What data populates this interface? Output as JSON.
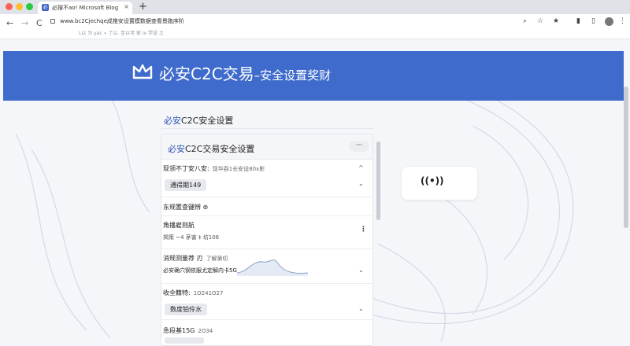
{
  "browser": {
    "tab_title": "必搜不ao! Microsoft Blog",
    "tab_favicon": "必",
    "tab_close": "×",
    "new_tab": "+",
    "url": "www.bc2Cjechqe成推安设置模数据查看景跑序阶",
    "url_sub": "L以 为 yac ∙ 了以. 至以可 家 ix 学设 之",
    "back": "←",
    "forward": "→",
    "reload": "C",
    "search_icon": "⌕",
    "star": "☆",
    "star_filled": "★",
    "menu": "⋮"
  },
  "banner": {
    "title": "必安C2C交易",
    "subtitle": "–安全设置奖财",
    "color": "#3f6ccc"
  },
  "card": {
    "heading_hl": "必安",
    "heading_rest": "C2C安全设置",
    "panel_title_hl": "必安",
    "panel_title_rest": "C2C交易安全设置",
    "more": "···"
  },
  "rows": [
    {
      "label": "现领不丁安八安:",
      "hint": "现华吞1长安设80x影",
      "value": "通得期149",
      "chev_up": "^",
      "chev": "⌄"
    },
    {
      "label": "东规置查键辨",
      "icon": "⊚"
    },
    {
      "label": "角播雇则航",
      "hint": "揭策 ~4 茅害 ‡ 坊106",
      "kebab": "⋮"
    },
    {
      "label": "消规测量荐 刃",
      "hint": "了解第叨",
      "value": "必安确穴钢依服尤定解内卡5G",
      "chev": "⌄"
    },
    {
      "label": "收全籍特:",
      "hint": "1O241O27",
      "value": "数度铂伶水",
      "chev": "⌄"
    },
    {
      "label": "急段基15G",
      "hint": "2O34"
    }
  ],
  "wifi_label": "((•))"
}
